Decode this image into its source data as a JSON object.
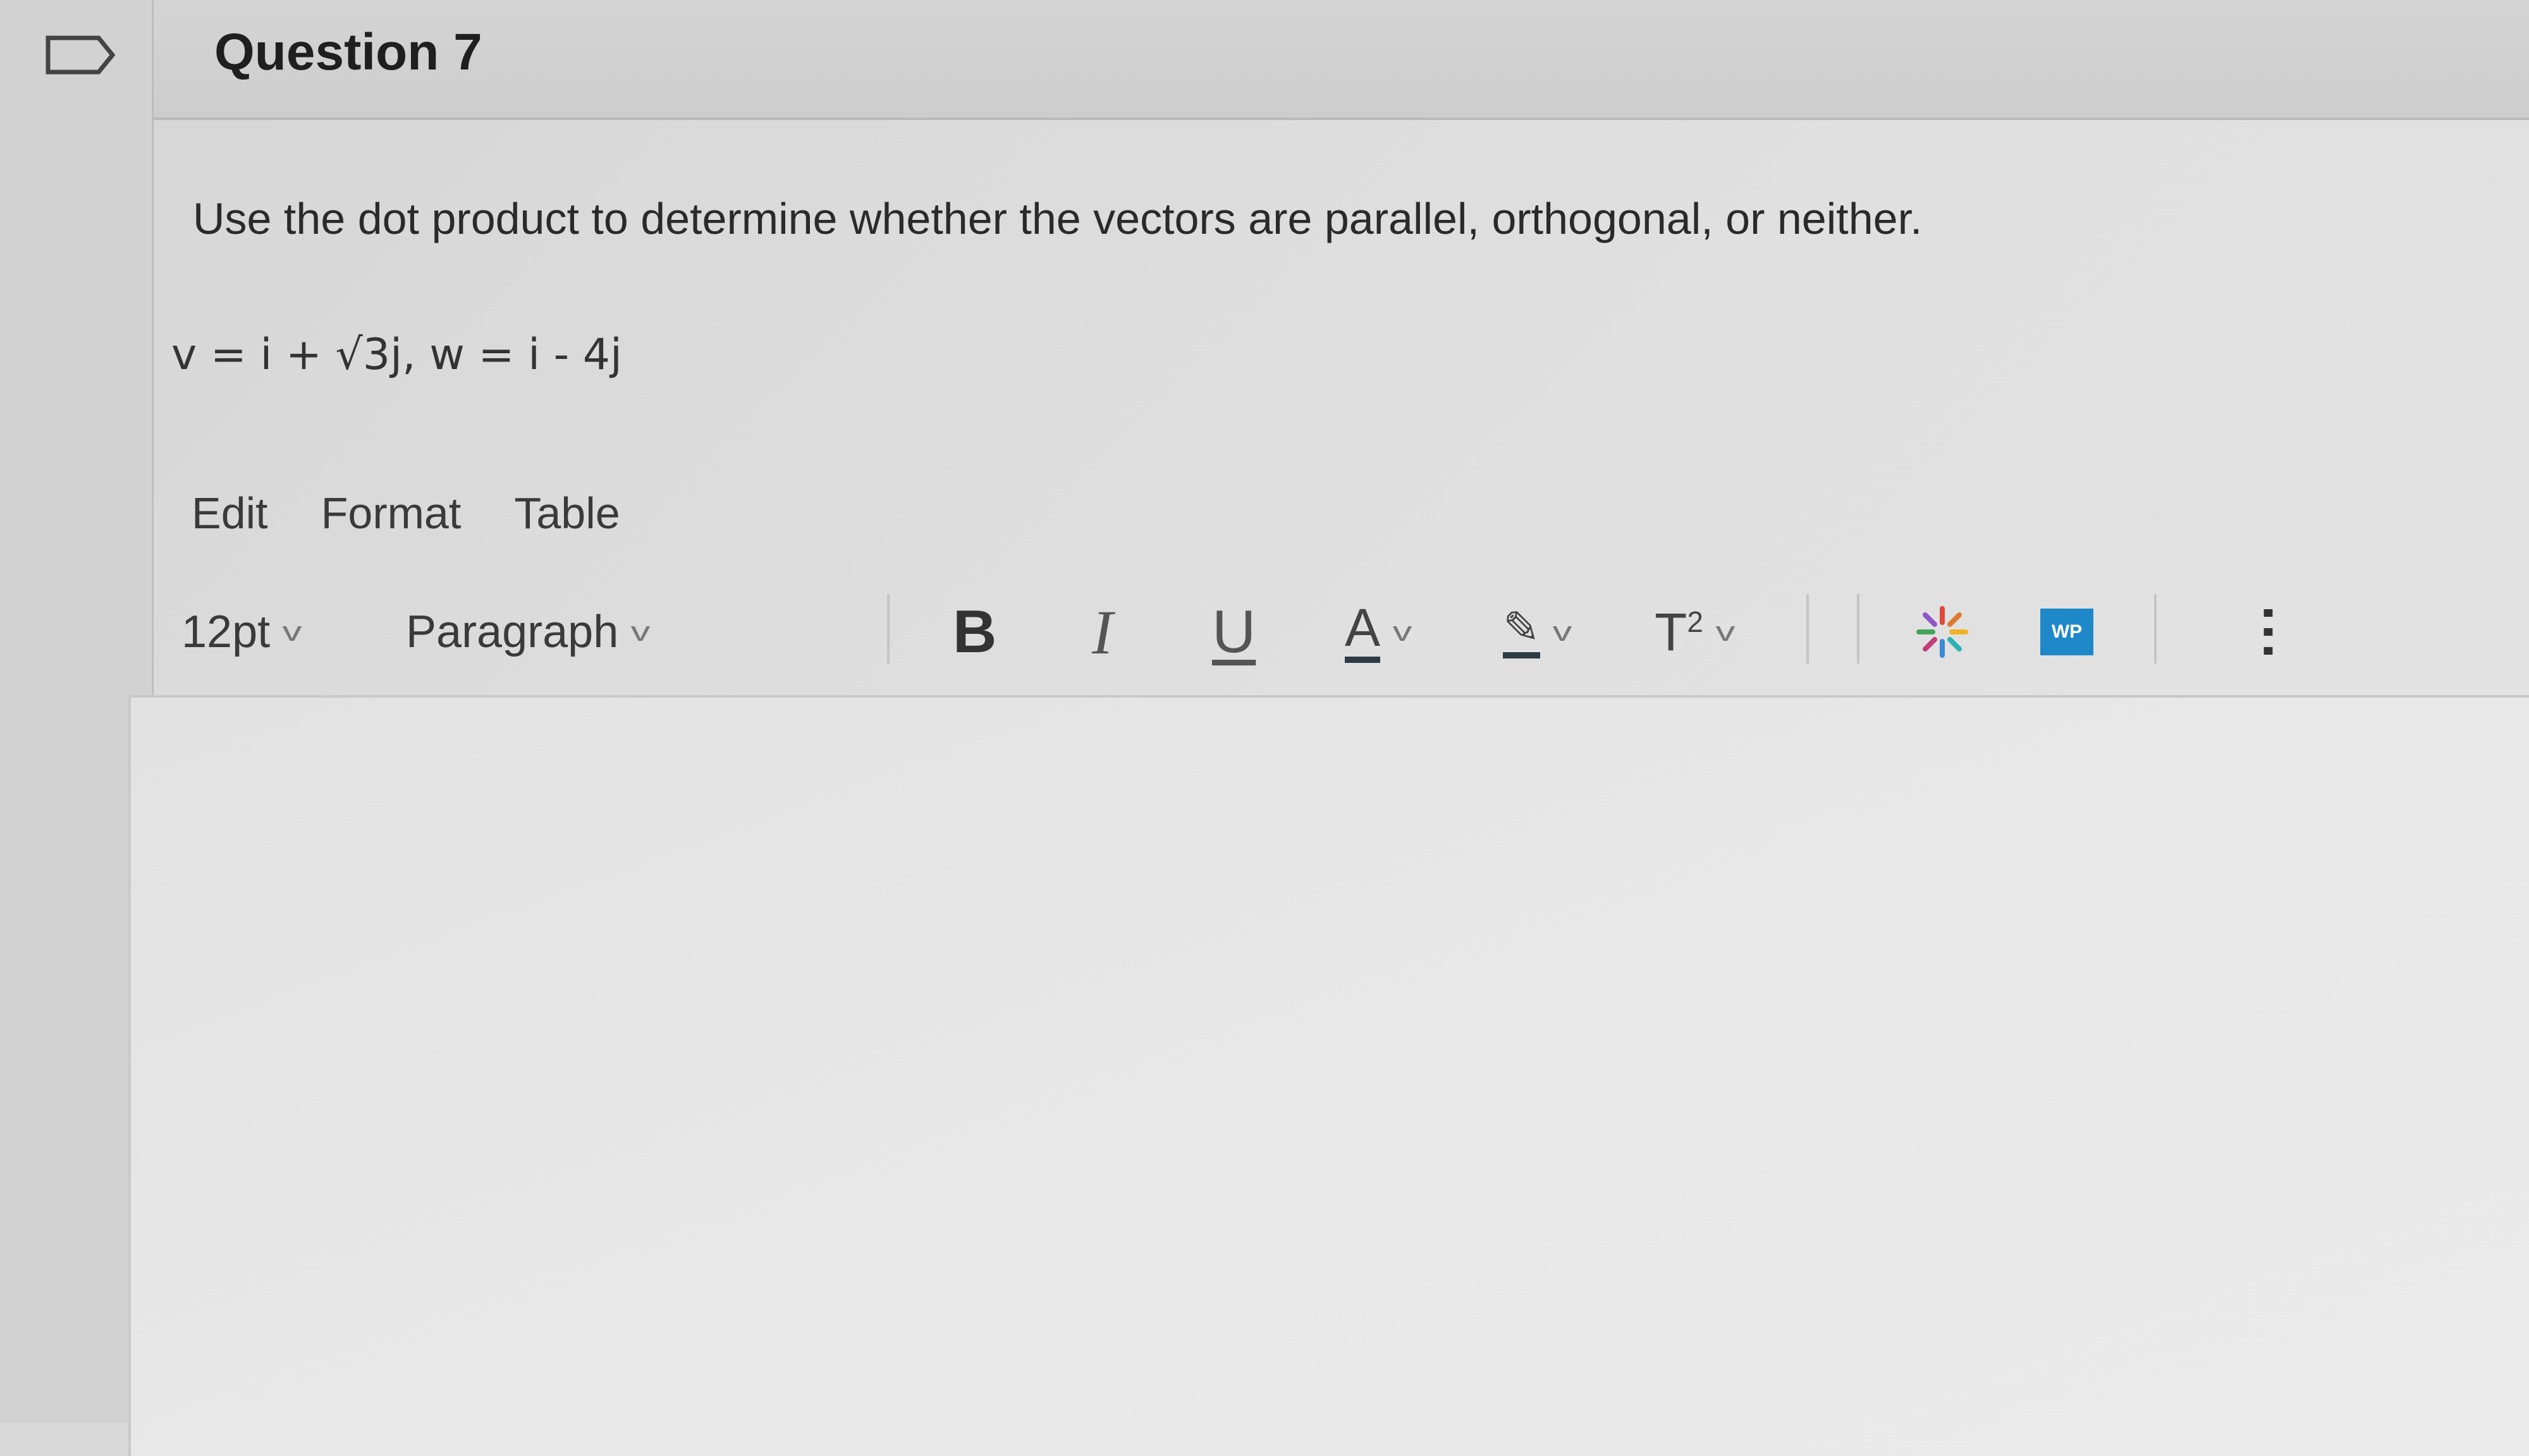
{
  "question": {
    "title": "Question 7",
    "prompt": "Use the dot product to determine whether the vectors are parallel, orthogonal, or neither.",
    "equation": "v = i + √3j, w = i - 4j"
  },
  "editor": {
    "menu": {
      "edit": "Edit",
      "format": "Format",
      "table": "Table"
    },
    "toolbar": {
      "font_size": "12pt",
      "block_format": "Paragraph",
      "bold": "B",
      "italic": "I",
      "underline": "U",
      "text_color": "A",
      "superscript": "T",
      "superscript_mark": "2",
      "wp_label": "WP"
    },
    "content": ""
  },
  "colors": {
    "wp_badge": "#1e88c8",
    "text": "#2d3b45"
  }
}
